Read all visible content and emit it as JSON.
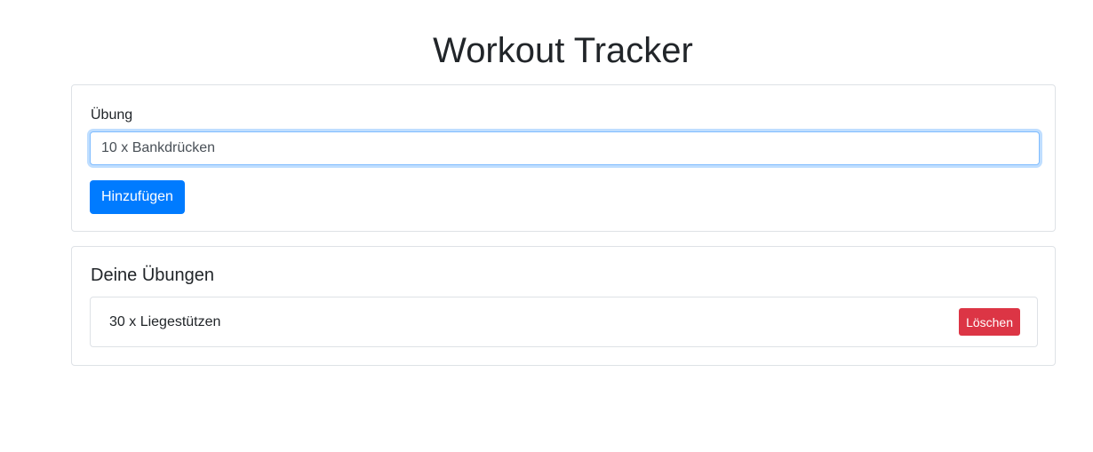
{
  "header": {
    "title": "Workout Tracker"
  },
  "form": {
    "label": "Übung",
    "input_value": "10 x Bankdrücken",
    "add_label": "Hinzufügen"
  },
  "list": {
    "title": "Deine Übungen",
    "items": [
      {
        "text": "30 x Liegestützen",
        "delete_label": "Löschen"
      }
    ]
  },
  "colors": {
    "primary": "#007bff",
    "danger": "#dc3545",
    "border": "#dee2e6",
    "focus": "#80bdff"
  }
}
